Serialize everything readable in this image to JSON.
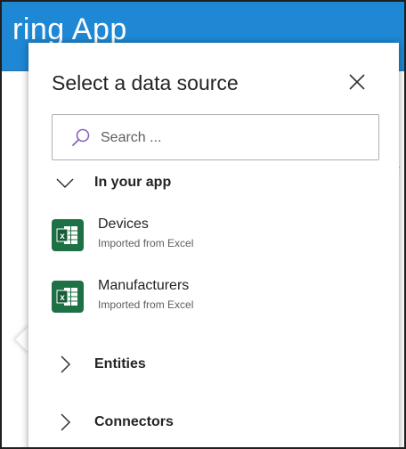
{
  "app": {
    "title": "ring App"
  },
  "panel": {
    "title": "Select a data source",
    "close_icon": "close-icon",
    "search": {
      "placeholder": "Search ...",
      "value": "",
      "icon": "search-icon"
    }
  },
  "sections": [
    {
      "label": "In your app",
      "expanded": true,
      "items": [
        {
          "name": "Devices",
          "subtitle": "Imported from Excel",
          "icon": "excel-table-icon"
        },
        {
          "name": "Manufacturers",
          "subtitle": "Imported from Excel",
          "icon": "excel-table-icon"
        }
      ]
    },
    {
      "label": "Entities",
      "expanded": false
    },
    {
      "label": "Connectors",
      "expanded": false
    }
  ],
  "colors": {
    "header": "#1e88d4",
    "excel_green": "#1e7145",
    "search_accent": "#8764b8"
  }
}
